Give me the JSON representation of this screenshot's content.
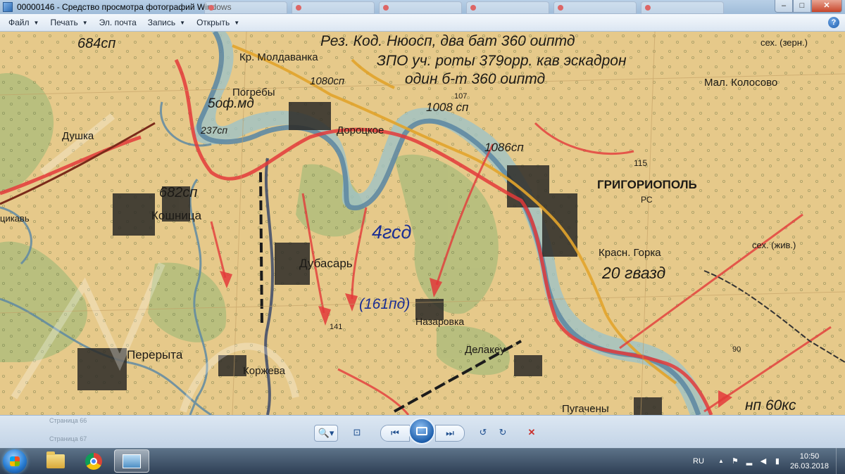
{
  "window": {
    "title": "00000146 - Средство просмотра фотографий Windows",
    "controls": {
      "minimize": "–",
      "maximize": "□",
      "close": "✕"
    },
    "icon": "photo-viewer-icon"
  },
  "menu": [
    {
      "label": "Файл",
      "has_caret": true
    },
    {
      "label": "Печать",
      "has_caret": true
    },
    {
      "label": "Эл. почта",
      "has_caret": false
    },
    {
      "label": "Запись",
      "has_caret": true
    },
    {
      "label": "Открыть",
      "has_caret": true
    }
  ],
  "help_label": "?",
  "map": {
    "labels": {
      "l684": "684сп",
      "rezerv": "Рез. Код. Нюосп, два бат 360 оиптд",
      "moldavanka": "Кр. Молдаванка",
      "unit2": "ЗПО уч. роты 379орр. кав эскадрон",
      "unit3": "один б-т 360 оиптд",
      "sekh_zern": "сех. (зерн.)",
      "mal_kolosovo": "Мал. Колосово",
      "pogreby": "Погребы",
      "c1080": "1080сп",
      "h107": "107",
      "c1008": "1008 сп",
      "of5": "5оф.мд",
      "c237": "237сп",
      "doroczkoe": "Дороцкое",
      "dushka": "Душка",
      "c1086": "1086сп",
      "h115": "115",
      "grigoriopol": "ГРИГОРИОПОЛЬ",
      "rs": "РС",
      "c682": "682сп",
      "koshnitsa": "Кошница",
      "tsikav": "цикавь",
      "csd": "4гсд",
      "sekh_zhiv": "сех. (жив.)",
      "krasn_gorka": "Красн. Горка",
      "azd20": "20 гвазд",
      "dubasar": "Дубасарь",
      "c161": "(161пд)",
      "nazarovka": "Назаровка",
      "h141": "141",
      "delakeu": "Делакеу",
      "h90": "90",
      "pererita": "Перерыта",
      "korzheva": "Коржева",
      "pugacheni": "Пугачены",
      "np60": "нп 60кс"
    }
  },
  "viewer_controls": {
    "ghost_text_1": "Страница 66",
    "ghost_text_2": "Страница 67",
    "zoom": "🔍▾",
    "fit": "⊡",
    "prev": "⏮",
    "next": "⏭",
    "rotate_ccw": "↺",
    "rotate_cw": "↻",
    "delete": "✕"
  },
  "taskbar": {
    "language": "RU",
    "time": "10:50",
    "date": "26.03.2018",
    "tray_expand": "▲"
  },
  "colors": {
    "map_paper": "#e6c98a",
    "river": "#6f93a8",
    "front_red": "#e33a3a",
    "road_orange": "#e2a42b",
    "marking_blue": "#2a3fa0"
  }
}
